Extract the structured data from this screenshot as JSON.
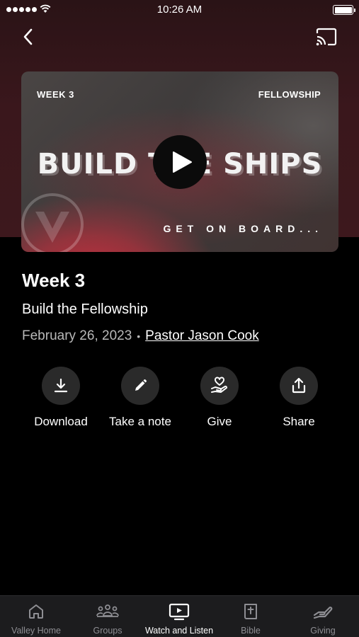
{
  "status_bar": {
    "time": "10:26 AM",
    "signal_dots": 5
  },
  "nav": {
    "back_icon": "chevron-left-icon",
    "cast_icon": "cast-icon"
  },
  "video": {
    "week_label": "WEEK 3",
    "tag_label": "FELLOWSHIP",
    "title": "BUILD THE SHIPS",
    "tagline": "GET ON BOARD...",
    "play_icon": "play-icon"
  },
  "episode": {
    "title": "Week 3",
    "subtitle": "Build the Fellowship",
    "date": "February 26, 2023",
    "separator": "•",
    "speaker": "Pastor Jason Cook"
  },
  "actions": [
    {
      "label": "Download",
      "icon": "download-icon"
    },
    {
      "label": "Take a note",
      "icon": "pencil-icon"
    },
    {
      "label": "Give",
      "icon": "give-heart-hand-icon"
    },
    {
      "label": "Share",
      "icon": "share-icon"
    }
  ],
  "tabs": [
    {
      "label": "Valley Home",
      "icon": "home-icon",
      "active": false
    },
    {
      "label": "Groups",
      "icon": "groups-icon",
      "active": false
    },
    {
      "label": "Watch and Listen",
      "icon": "tv-play-icon",
      "active": true
    },
    {
      "label": "Bible",
      "icon": "bible-icon",
      "active": false
    },
    {
      "label": "Giving",
      "icon": "giving-hand-icon",
      "active": false
    }
  ],
  "colors": {
    "background": "#000000",
    "hero_background": "#3a171c",
    "action_circle": "#2a2a2a",
    "tab_bar": "#1c1c1e",
    "tab_inactive": "#8e8e93",
    "meta_text": "#b9b9b9"
  }
}
